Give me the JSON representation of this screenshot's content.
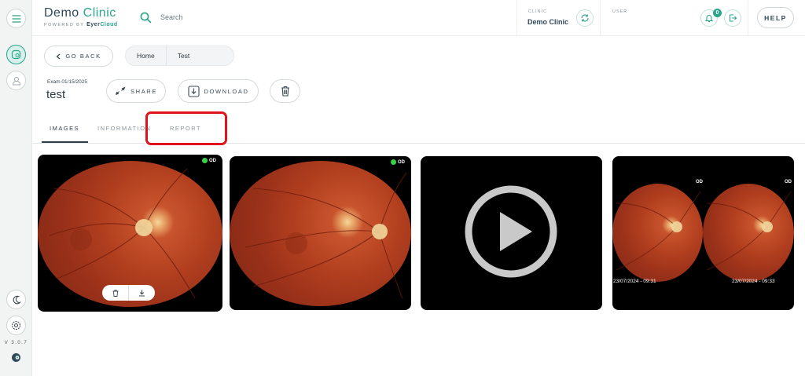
{
  "brand": {
    "name_part1": "Demo",
    "name_part2": "Clinic",
    "powered_by": "POWERED BY",
    "cloud_part1": "Eyer",
    "cloud_part2": "Cloud"
  },
  "search": {
    "placeholder": "Search"
  },
  "clinic": {
    "label": "CLINIC",
    "name": "Demo Clinic"
  },
  "user": {
    "label": "USER"
  },
  "notifications": {
    "count": "0"
  },
  "help_label": "HELP",
  "version": "V 3.0.7",
  "toolbar": {
    "go_back": "GO BACK",
    "share": "SHARE",
    "download": "DOWNLOAD"
  },
  "breadcrumb": [
    "Home",
    "Test"
  ],
  "exam": {
    "label": "Exam 01/15/2025",
    "name": "test"
  },
  "tabs": [
    {
      "label": "IMAGES",
      "active": true
    },
    {
      "label": "INFORMATION",
      "active": false
    },
    {
      "label": "REPORT",
      "active": false
    }
  ],
  "images": [
    {
      "type": "fundus",
      "eye": "OD"
    },
    {
      "type": "fundus",
      "eye": "OD"
    },
    {
      "type": "video"
    },
    {
      "type": "stereo",
      "eye": "OD",
      "timestamps": [
        "23/07/2024 - 09:31",
        "23/07/2024 - 09:33"
      ]
    }
  ],
  "colors": {
    "accent": "#2aa58a",
    "highlight": "#e0131a",
    "status_dot": "#3ad14a"
  }
}
